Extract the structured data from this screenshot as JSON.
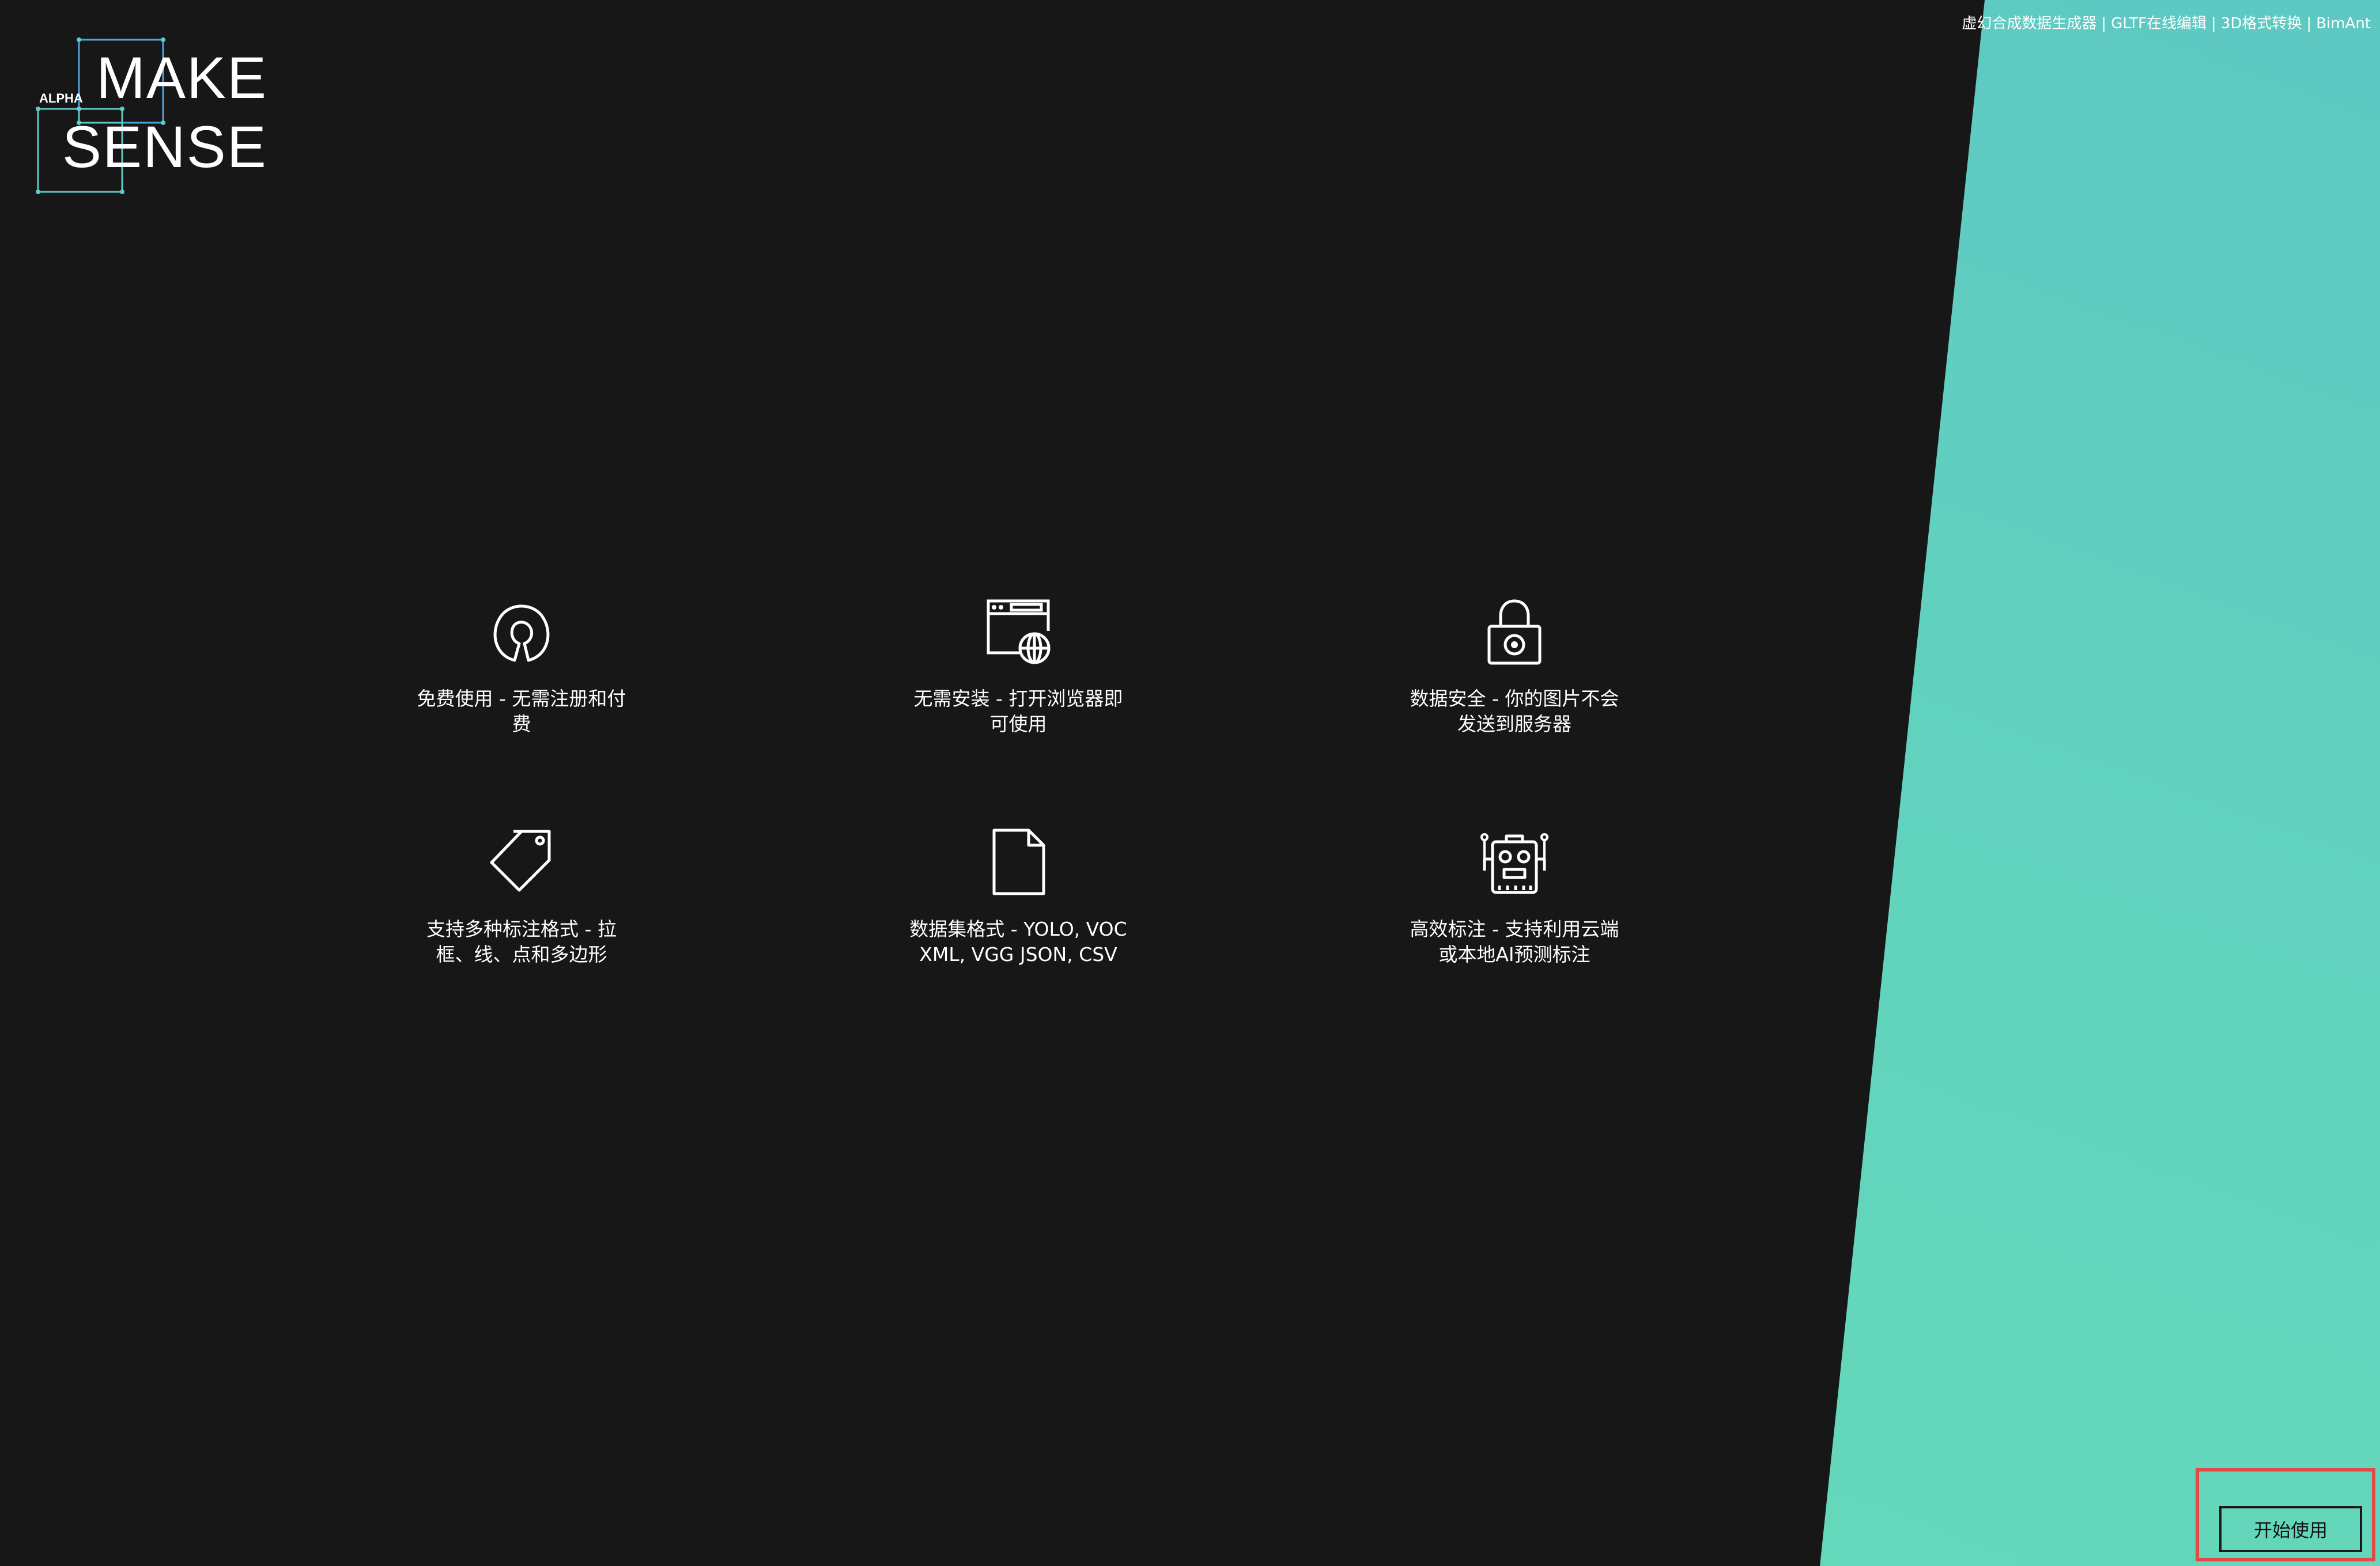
{
  "header": {
    "links": [
      "虚幻合成数据生成器",
      "GLTF在线编辑",
      "3D格式转换",
      "BimAnt"
    ],
    "separator": "|"
  },
  "logo": {
    "alpha": "ALPHA",
    "make": "MAKE",
    "sense": "SENSE",
    "accent_colors": [
      "#4fa3e0",
      "#5ecbc4"
    ]
  },
  "features": [
    {
      "icon": "open-source-icon",
      "text": "免费使用 - 无需注册和付费"
    },
    {
      "icon": "browser-globe-icon",
      "text": "无需安装 - 打开浏览器即可使用"
    },
    {
      "icon": "lock-icon",
      "text": "数据安全 - 你的图片不会发送到服务器"
    },
    {
      "icon": "tag-icon",
      "text": "支持多种标注格式 - 拉框、线、点和多边形"
    },
    {
      "icon": "file-icon",
      "text": "数据集格式 - YOLO, VOC XML, VGG JSON, CSV"
    },
    {
      "icon": "robot-icon",
      "text": "高效标注 - 支持利用云端或本地AI预测标注"
    }
  ],
  "start_button": {
    "label": "开始使用"
  },
  "colors": {
    "background": "#171717",
    "accent_teal": "#62d4bd",
    "highlight": "#e24a4a"
  }
}
